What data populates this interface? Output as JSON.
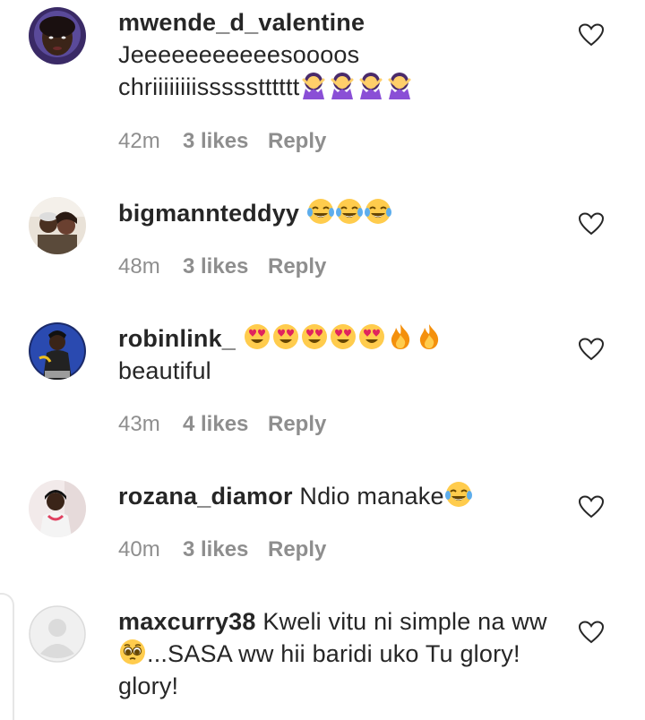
{
  "comments": [
    {
      "username": "mwende_d_valentine",
      "line1": "Jeeeeeeeeeeesoooos",
      "line2": "chriiiiiiiissssstttttt",
      "time": "42m",
      "likes": "3 likes",
      "reply": "Reply",
      "emojis": [
        "woman-gesturing-no-emoji",
        "woman-gesturing-no-emoji",
        "woman-gesturing-no-emoji",
        "woman-gesturing-no-emoji"
      ]
    },
    {
      "username": "bigmannteddyy",
      "text": "",
      "time": "48m",
      "likes": "3 likes",
      "reply": "Reply",
      "emojis": [
        "tears-of-joy-emoji",
        "tears-of-joy-emoji",
        "tears-of-joy-emoji"
      ]
    },
    {
      "username": "robinlink_",
      "line2": "beautiful",
      "time": "43m",
      "likes": "4 likes",
      "reply": "Reply",
      "emojis": [
        "heart-eyes-emoji",
        "heart-eyes-emoji",
        "heart-eyes-emoji",
        "heart-eyes-emoji",
        "heart-eyes-emoji",
        "fire-emoji",
        "fire-emoji"
      ]
    },
    {
      "username": "rozana_diamor",
      "text": "Ndio manake",
      "time": "40m",
      "likes": "3 likes",
      "reply": "Reply",
      "emojis": [
        "tears-of-joy-emoji"
      ]
    },
    {
      "username": "maxcurry38",
      "text": "Kweli vitu ni simple na ww",
      "line2": "...SASA ww hii baridi uko Tu glory!",
      "line3": "glory!",
      "emojis": [
        "pleading-face-emoji"
      ]
    }
  ],
  "colors": {
    "text": "#262626",
    "meta": "#8e8e8e"
  }
}
